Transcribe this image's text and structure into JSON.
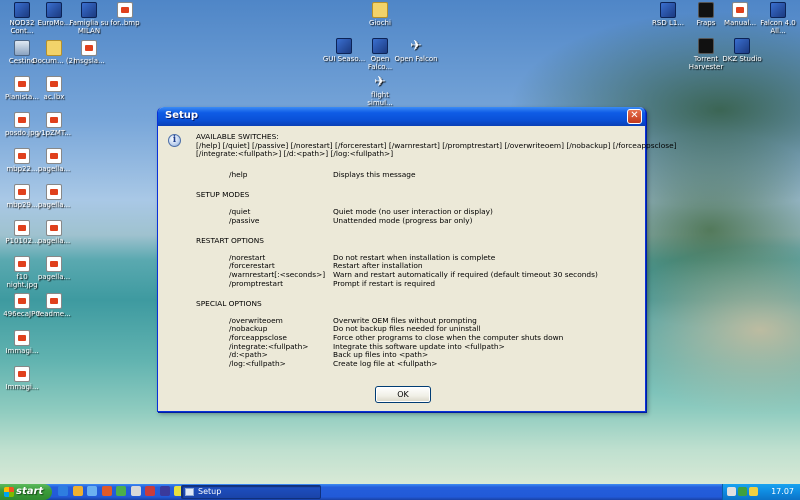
{
  "desktop": {
    "icons": [
      {
        "label": "NOD32 Cont...",
        "icon": "app-icon"
      },
      {
        "label": "EuroMo...",
        "icon": "app-icon"
      },
      {
        "label": "Famiglia su MILAN",
        "icon": "app-icon"
      },
      {
        "label": "for..bmp",
        "icon": "image-file-icon"
      },
      {
        "label": "Cestino",
        "icon": "recycle-bin-icon"
      },
      {
        "label": "Docum... (2)",
        "icon": "documents-icon"
      },
      {
        "label": "msgsla...",
        "icon": "image-file-icon"
      },
      {
        "label": "Pianista...",
        "icon": "image-file-icon"
      },
      {
        "label": "ac.lbx",
        "icon": "image-file-icon"
      },
      {
        "label": "posdo.jpg",
        "icon": "image-file-icon"
      },
      {
        "label": "y1pZMT...",
        "icon": "image-file-icon"
      },
      {
        "label": "mbp22...",
        "icon": "image-file-icon"
      },
      {
        "label": "pagella...",
        "icon": "image-file-icon"
      },
      {
        "label": "mbp29...",
        "icon": "image-file-icon"
      },
      {
        "label": "pagella...",
        "icon": "image-file-icon"
      },
      {
        "label": "P10102...",
        "icon": "image-file-icon"
      },
      {
        "label": "pagella...",
        "icon": "image-file-icon"
      },
      {
        "label": "f10 night.jpg",
        "icon": "image-file-icon"
      },
      {
        "label": "pagella...",
        "icon": "image-file-icon"
      },
      {
        "label": "496ecaJPG",
        "icon": "image-file-icon"
      },
      {
        "label": "readme...",
        "icon": "text-file-icon"
      },
      {
        "label": "Immagi...",
        "icon": "image-file-icon"
      },
      {
        "label": "Immagi...",
        "icon": "image-file-icon"
      },
      {
        "label": "Giochi",
        "icon": "folder-icon"
      },
      {
        "label": "GUI Seaso...",
        "icon": "app-icon"
      },
      {
        "label": "Open Falco...",
        "icon": "app-icon"
      },
      {
        "label": "Open Falcon",
        "icon": "airplane-icon"
      },
      {
        "label": "flight simul...",
        "icon": "airplane-icon"
      },
      {
        "label": "RSD L1...",
        "icon": "app-icon"
      },
      {
        "label": "Fraps",
        "icon": "app-icon"
      },
      {
        "label": "Manual...",
        "icon": "document-icon"
      },
      {
        "label": "Falcon 4.0 All...",
        "icon": "app-icon"
      },
      {
        "label": "Torrent Harvester",
        "icon": "app-icon"
      },
      {
        "label": "DKZ Studio",
        "icon": "app-icon"
      }
    ]
  },
  "dialog": {
    "title": "Setup",
    "close_symbol": "✕",
    "icon_glyph": "i",
    "available_switches_heading": "AVAILABLE SWITCHES:",
    "switches_line1": "[/help] [/quiet] [/passive] [/norestart] [/forcerestart] [/warnrestart] [/promptrestart] [/overwriteoem] [/nobackup] [/forceappsclose]",
    "switches_line2": "[/integrate:<fullpath>] [/d:<path>] [/log:<fullpath>]",
    "help": {
      "key": "/help",
      "desc": "Displays this message"
    },
    "setup_modes": {
      "heading": "SETUP MODES",
      "options": [
        {
          "key": "/quiet",
          "desc": "Quiet mode (no user interaction or display)"
        },
        {
          "key": "/passive",
          "desc": "Unattended mode (progress bar only)"
        }
      ]
    },
    "restart_options": {
      "heading": "RESTART OPTIONS",
      "options": [
        {
          "key": "/norestart",
          "desc": "Do not restart when installation is complete"
        },
        {
          "key": "/forcerestart",
          "desc": "Restart after installation"
        },
        {
          "key": "/warnrestart[:<seconds>]",
          "desc": "Warn and restart automatically if required (default timeout 30 seconds)"
        },
        {
          "key": "/promptrestart",
          "desc": "Prompt if restart is required"
        }
      ]
    },
    "special_options": {
      "heading": "SPECIAL OPTIONS",
      "options": [
        {
          "key": "/overwriteoem",
          "desc": "Overwrite OEM files without prompting"
        },
        {
          "key": "/nobackup",
          "desc": "Do not backup files needed for uninstall"
        },
        {
          "key": "/forceappsclose",
          "desc": "Force other programs to close when the computer shuts down"
        },
        {
          "key": "/integrate:<fullpath>",
          "desc": "Integrate this software update into <fullpath>"
        },
        {
          "key": "/d:<path>",
          "desc": "Back up files into <path>"
        },
        {
          "key": "/log:<fullpath>",
          "desc": "Create log file at <fullpath>"
        }
      ]
    },
    "ok_label": "OK"
  },
  "taskbar": {
    "start_label": "start",
    "task_label": "Setup",
    "clock": "17.07"
  }
}
